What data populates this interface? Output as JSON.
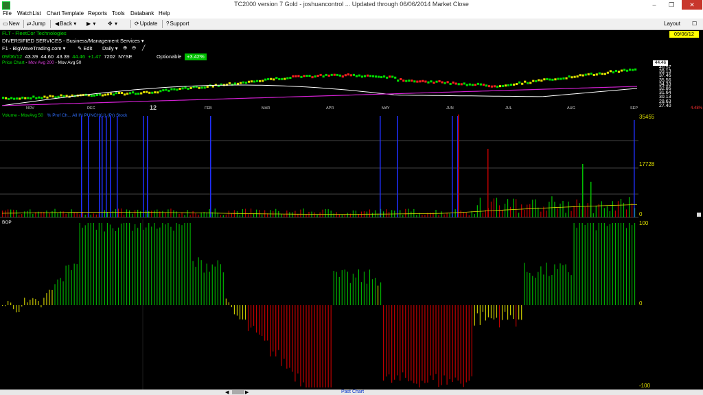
{
  "window": {
    "title": "TC2000 version 7 Gold - joshuancontrol ... Updated through 06/06/2014 Market Close",
    "controls": [
      "–",
      "❐",
      "✕"
    ]
  },
  "menu": [
    "File",
    "WatchList",
    "Chart Template",
    "Reports",
    "Tools",
    "Databank",
    "Help"
  ],
  "toolbar": {
    "new": "New",
    "jump": "Jump",
    "back": "Back",
    "update": "Update",
    "support": "Support",
    "layout": "Layout"
  },
  "chart": {
    "symbol_line": "FLT - FleetCor Technologies",
    "sector_line": "DIVERSIFIED SERVICES - Business/Management Services",
    "layout_name": "F1 - BigWaveTrading.com",
    "edit": "Edit",
    "period": "Daily",
    "date": "09/06/12",
    "open": "43.39",
    "high": "44.60",
    "low": "43.39",
    "close": "44.46",
    "change": "+1.47",
    "volume": "7202",
    "exchange": "NYSE",
    "optionable": "Optionable",
    "pct_change": "+3.42%",
    "date_badge": "09/06/12",
    "last_price": "44.46",
    "price_legend": [
      "Price Chart",
      "Mov Avg 200",
      "Mov Avg 50"
    ],
    "price_axis": [
      "40.57",
      "39.13",
      "37.46",
      "35.56",
      "34.33",
      "32.86",
      "31.64",
      "30.13",
      "28.63",
      "27.40"
    ],
    "pct_axis": "4.48%",
    "months": [
      "NOV",
      "DEC",
      "12",
      "FEB",
      "MAR",
      "APR",
      "MAY",
      "JUN",
      "JUL",
      "AUG",
      "SEP"
    ],
    "volume_legend": "Volume - MovAvg 50",
    "volume_overlay": "% Prof Ch... All IN PUNCH(U) (Pr) Stock",
    "volume_axis": [
      "35455",
      "17728",
      "0"
    ],
    "bop_label": "BOP",
    "bop_axis": [
      "100",
      "0",
      "-100"
    ],
    "past_chart": "Past Chart"
  }
}
